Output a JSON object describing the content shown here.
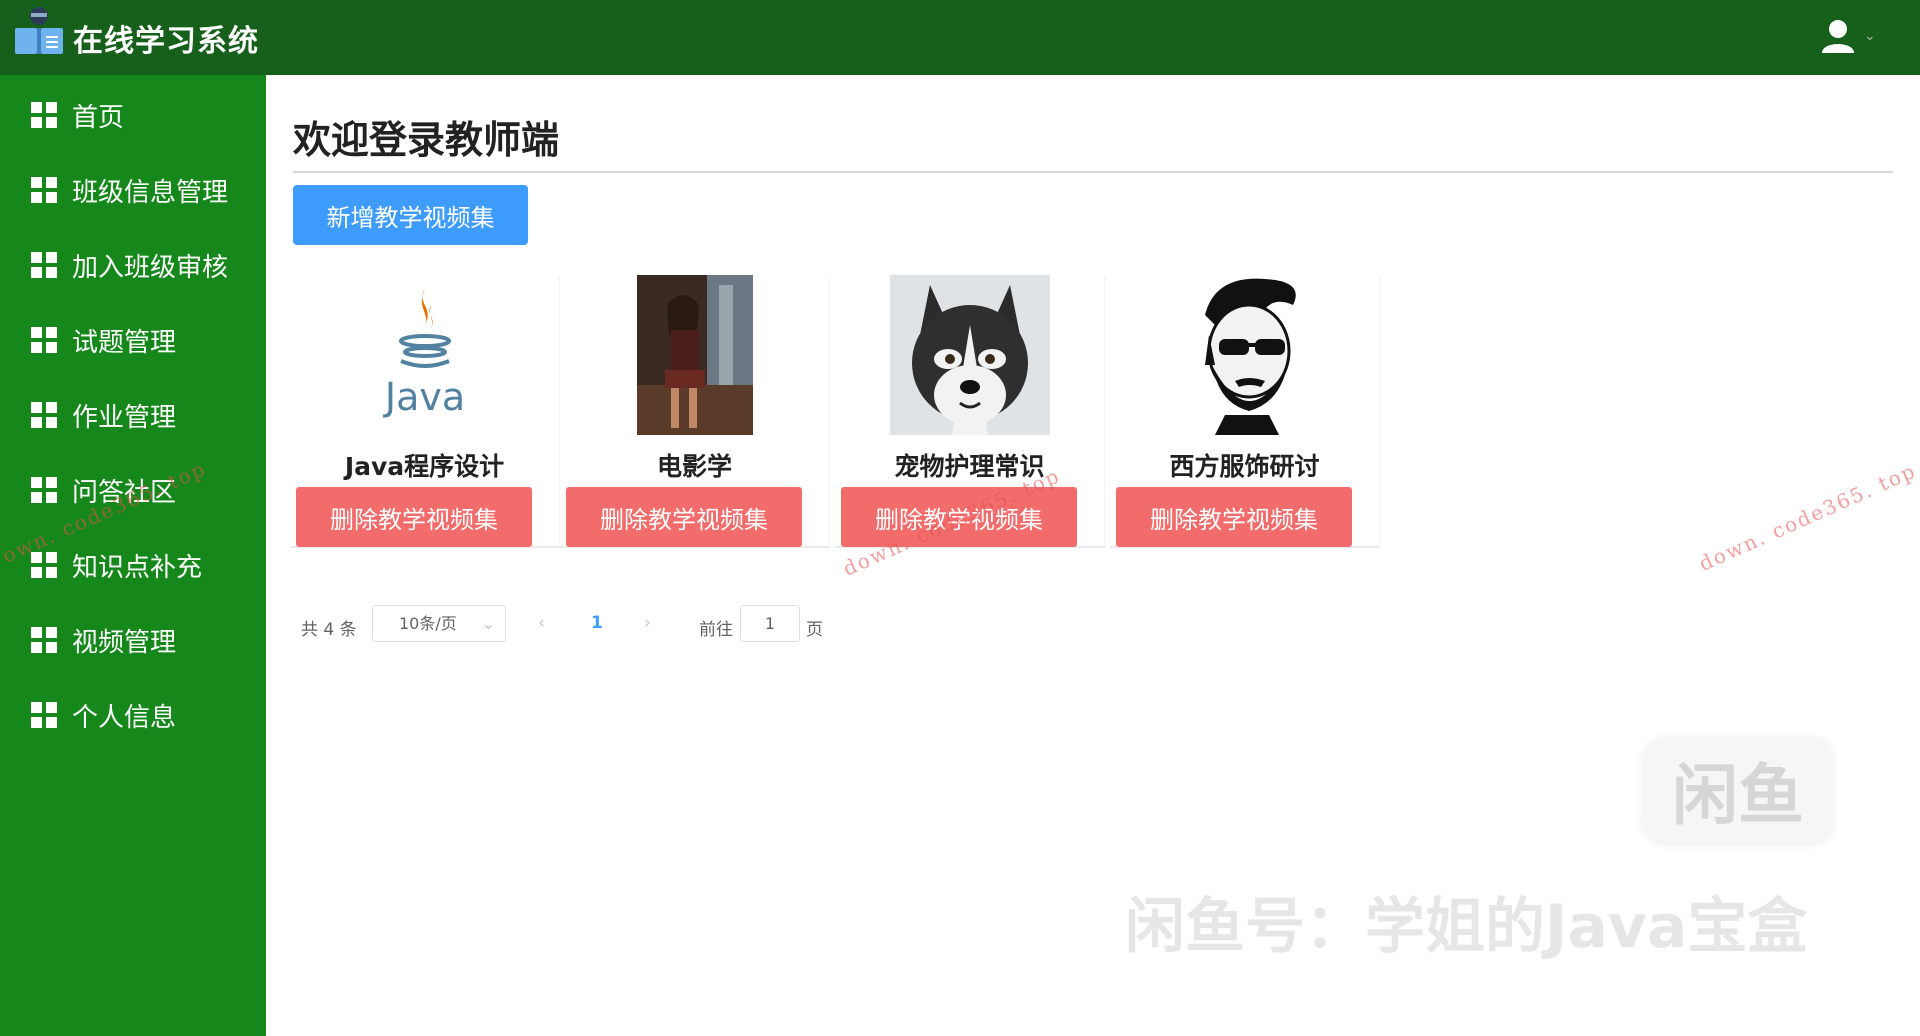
{
  "header": {
    "app_title": "在线学习系统",
    "logo_icon": "book-reader-icon",
    "user_icon": "user-icon",
    "caret": "⌄"
  },
  "sidebar": {
    "items": [
      {
        "label": "首页",
        "icon": "grid-icon"
      },
      {
        "label": "班级信息管理",
        "icon": "grid-icon"
      },
      {
        "label": "加入班级审核",
        "icon": "grid-icon"
      },
      {
        "label": "试题管理",
        "icon": "grid-icon"
      },
      {
        "label": "作业管理",
        "icon": "grid-icon"
      },
      {
        "label": "问答社区",
        "icon": "grid-icon"
      },
      {
        "label": "知识点补充",
        "icon": "grid-icon"
      },
      {
        "label": "视频管理",
        "icon": "grid-icon"
      },
      {
        "label": "个人信息",
        "icon": "grid-icon"
      }
    ]
  },
  "main": {
    "title": "欢迎登录教师端",
    "add_button": "新增教学视频集",
    "cards": [
      {
        "name": "Java程序设计",
        "delete_label": "删除教学视频集",
        "image": "java-logo"
      },
      {
        "name": "电影学",
        "delete_label": "删除教学视频集",
        "image": "movie-poster"
      },
      {
        "name": "宠物护理常识",
        "delete_label": "删除教学视频集",
        "image": "husky-dog"
      },
      {
        "name": "西方服饰研讨",
        "delete_label": "删除教学视频集",
        "image": "bearded-man"
      }
    ]
  },
  "pagination": {
    "total": "共 4 条",
    "page_size": "10条/页",
    "prev": "‹",
    "current_page": "1",
    "next": "›",
    "goto_label": "前往",
    "goto_value": "1",
    "page_suffix": "页"
  },
  "watermarks": {
    "site_a": "own. code365. top",
    "site_b": "down. code365. top",
    "site_c": "down. code365. top",
    "badge": "闲鱼",
    "seller": "闲鱼号：学姐的Java宝盒"
  },
  "colors": {
    "topbar": "#16601b",
    "sidebar": "#16881b",
    "primary": "#3f9cff",
    "danger": "#f26c6c"
  }
}
